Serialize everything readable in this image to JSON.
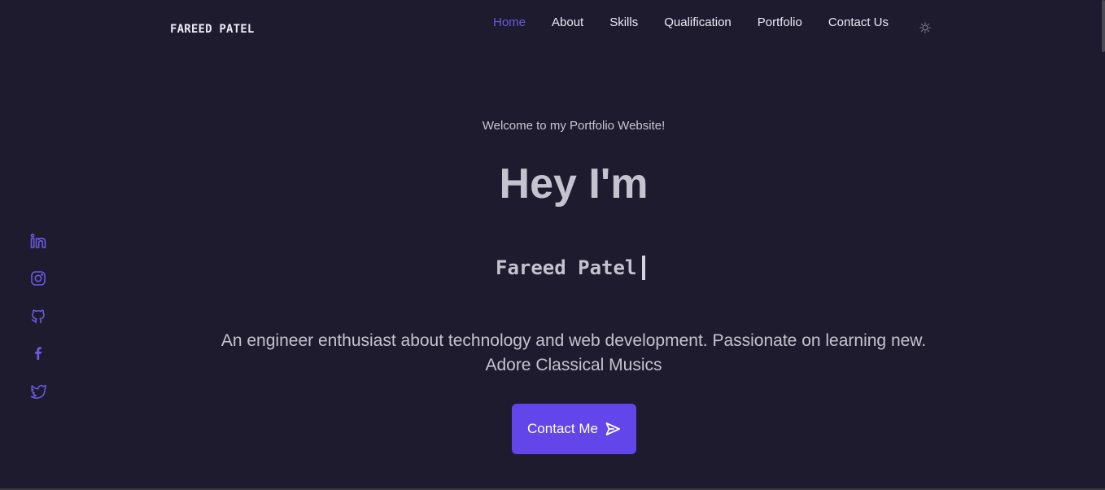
{
  "header": {
    "logo": "FAREED PATEL",
    "nav": [
      {
        "label": "Home",
        "active": true
      },
      {
        "label": "About"
      },
      {
        "label": "Skills"
      },
      {
        "label": "Qualification"
      },
      {
        "label": "Portfolio"
      },
      {
        "label": "Contact Us"
      }
    ],
    "theme_icon": "sun-icon"
  },
  "social": [
    "linkedin-icon",
    "instagram-icon",
    "github-icon",
    "facebook-icon",
    "twitter-icon"
  ],
  "hero": {
    "welcome": "Welcome to my Portfolio Website!",
    "greeting": "Hey I'm",
    "typed_name": "Fareed Patel",
    "description": "An engineer enthusiast about technology and web development. Passionate on learning new. Adore Classical Musics",
    "cta_label": "Contact Me",
    "cta_icon": "send-icon"
  },
  "colors": {
    "background": "#1e1b2e",
    "accent": "#6246ea",
    "nav_active": "#6b5ae0",
    "text": "#c6c3d0"
  }
}
